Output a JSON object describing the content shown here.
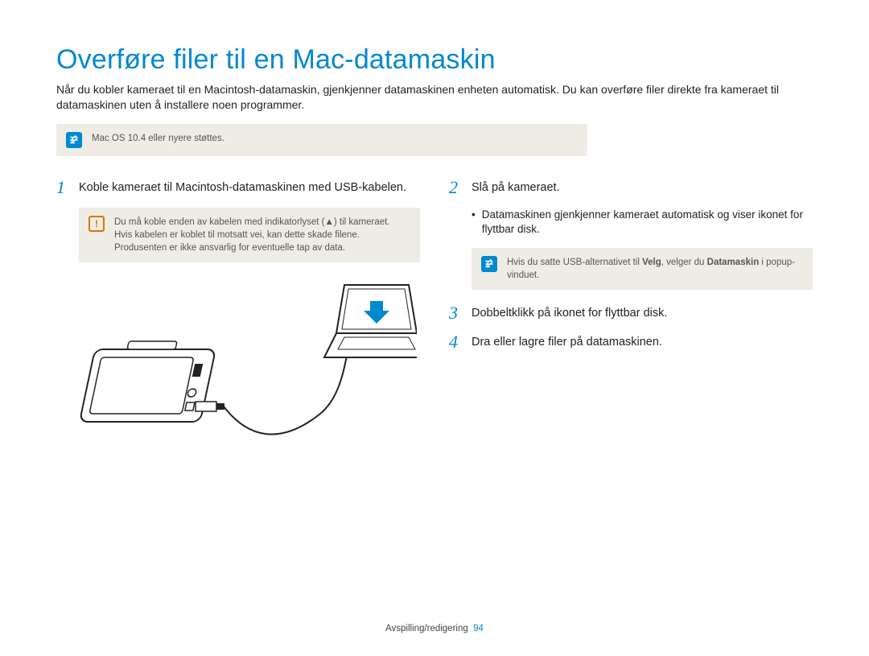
{
  "title": "Overføre filer til en Mac-datamaskin",
  "intro": "Når du kobler kameraet til en Macintosh-datamaskin, gjenkjenner datamaskinen enheten automatisk. Du kan overføre filer direkte fra kameraet til datamaskinen uten å installere noen programmer.",
  "topNote": "Mac OS 10.4 eller nyere støttes.",
  "left": {
    "step1_num": "1",
    "step1_text": "Koble kameraet til Macintosh-datamaskinen med USB-kabelen.",
    "warn_pre": "Du må koble enden av kabelen med indikatorlyset (",
    "warn_post": ") til kameraet. Hvis kabelen er koblet til motsatt vei, kan dette skade filene. Produsenten er ikke ansvarlig for eventuelle tap av data."
  },
  "right": {
    "step2_num": "2",
    "step2_text": "Slå på kameraet.",
    "step2_bullet": "Datamaskinen gjenkjenner kameraet automatisk og viser ikonet for flyttbar disk.",
    "info_pre": "Hvis du satte USB-alternativet til ",
    "info_bold1": "Velg",
    "info_mid": ", velger du ",
    "info_bold2": "Datamaskin",
    "info_post": " i popup-vinduet.",
    "step3_num": "3",
    "step3_text": "Dobbeltklikk på ikonet for flyttbar disk.",
    "step4_num": "4",
    "step4_text": "Dra eller lagre filer på datamaskinen."
  },
  "footer_label": "Avspilling/redigering",
  "footer_page": "94"
}
